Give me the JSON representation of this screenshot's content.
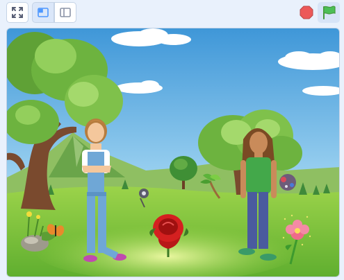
{
  "toolbar": {
    "fullscreen_icon": "fullscreen-icon",
    "small_stage_icon": "small-stage-layout-icon",
    "large_stage_icon": "large-stage-layout-icon",
    "stop_icon": "stop-sign-icon",
    "green_flag_icon": "green-flag-icon"
  },
  "colors": {
    "sky_top": "#3f97d8",
    "sky_bottom": "#bfe4f4",
    "grass": "#7fc43e",
    "stop_red": "#ec5959",
    "flag_green": "#4cbf56"
  },
  "stage": {
    "sprites": [
      "tree-left",
      "tree-right",
      "small-tree",
      "girl-blonde",
      "girl-brunette",
      "red-rose",
      "pink-flower",
      "butterfly",
      "rock-with-flowers",
      "glitter-sprite-1",
      "glitter-sprite-2",
      "palm-sapling"
    ]
  }
}
